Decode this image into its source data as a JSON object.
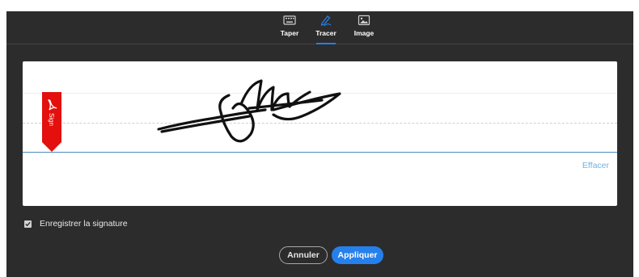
{
  "tabs": [
    {
      "label": "Taper",
      "icon": "keyboard-icon",
      "active": false
    },
    {
      "label": "Tracer",
      "icon": "pen-draw-icon",
      "active": true
    },
    {
      "label": "Image",
      "icon": "image-icon",
      "active": false
    }
  ],
  "canvas": {
    "ribbon_label": "Sign",
    "clear_label": "Effacer"
  },
  "save_signature": {
    "label": "Enregistrer la signature",
    "checked": true
  },
  "buttons": {
    "cancel_label": "Annuler",
    "apply_label": "Appliquer"
  },
  "colors": {
    "dialog_bg": "#2c2c2c",
    "accent": "#2680eb",
    "ribbon_red": "#e3100e",
    "link": "#6fb1e4"
  }
}
